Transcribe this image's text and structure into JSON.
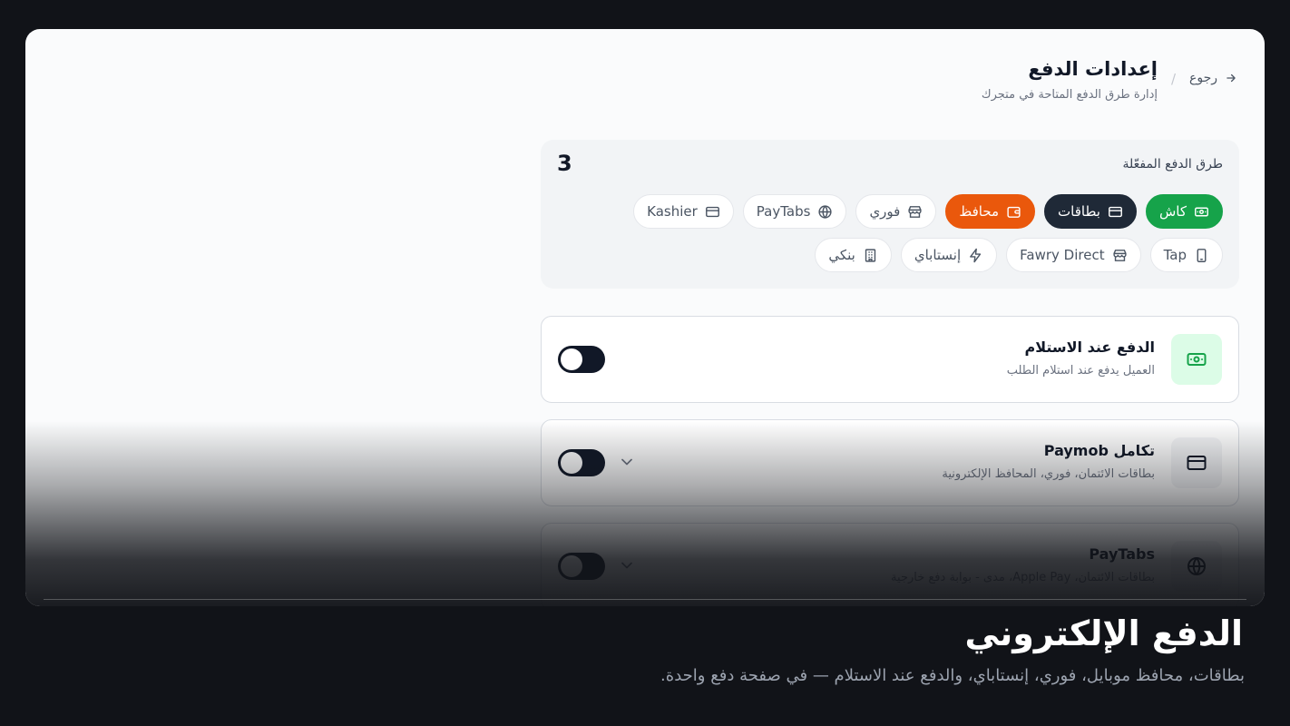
{
  "header": {
    "back_label": "رجوع",
    "separator": "/",
    "title": "إعدادات الدفع",
    "subtitle": "إدارة طرق الدفع المتاحة في متجرك"
  },
  "enabled_panel": {
    "label": "طرق الدفع المفعّلة",
    "count": "3",
    "chips": [
      {
        "label": "كاش",
        "icon": "cash-icon",
        "state": "active",
        "color": "#16a34a"
      },
      {
        "label": "بطاقات",
        "icon": "card-icon",
        "state": "active",
        "color": "#1f2937"
      },
      {
        "label": "محافظ",
        "icon": "wallet-icon",
        "state": "active",
        "color": "#ea580c"
      },
      {
        "label": "فوري",
        "icon": "store-icon",
        "state": "inactive"
      },
      {
        "label": "PayTabs",
        "icon": "globe-icon",
        "state": "inactive"
      },
      {
        "label": "Kashier",
        "icon": "card-icon",
        "state": "inactive"
      },
      {
        "label": "Tap",
        "icon": "phone-icon",
        "state": "inactive"
      },
      {
        "label": "Fawry Direct",
        "icon": "store-icon",
        "state": "inactive"
      },
      {
        "label": "إنستاباي",
        "icon": "bolt-icon",
        "state": "inactive"
      },
      {
        "label": "بنكي",
        "icon": "bank-icon",
        "state": "inactive"
      }
    ]
  },
  "providers": [
    {
      "title": "الدفع عند الاستلام",
      "desc": "العميل يدفع عند استلام الطلب",
      "icon": "cash-icon",
      "enabled": false
    },
    {
      "title": "تكامل Paymob",
      "desc": "بطاقات الائتمان، فوري، المحافظ الإلكترونية",
      "icon": "card-icon",
      "enabled": false
    },
    {
      "title": "PayTabs",
      "desc": "بطاقات الائتمان، Apple Pay، مدى - بوابة دفع خارجية",
      "icon": "globe-icon",
      "enabled": false
    }
  ],
  "caption": {
    "title": "الدفع الإلكتروني",
    "subtitle": "بطاقات، محافظ موبايل، فوري، إنستاباي، والدفع عند الاستلام — في صفحة دفع واحدة."
  },
  "colors": {
    "accent_green": "#16a34a",
    "accent_navy": "#1f2937",
    "accent_orange": "#ea580c",
    "page_bg": "#111318"
  }
}
